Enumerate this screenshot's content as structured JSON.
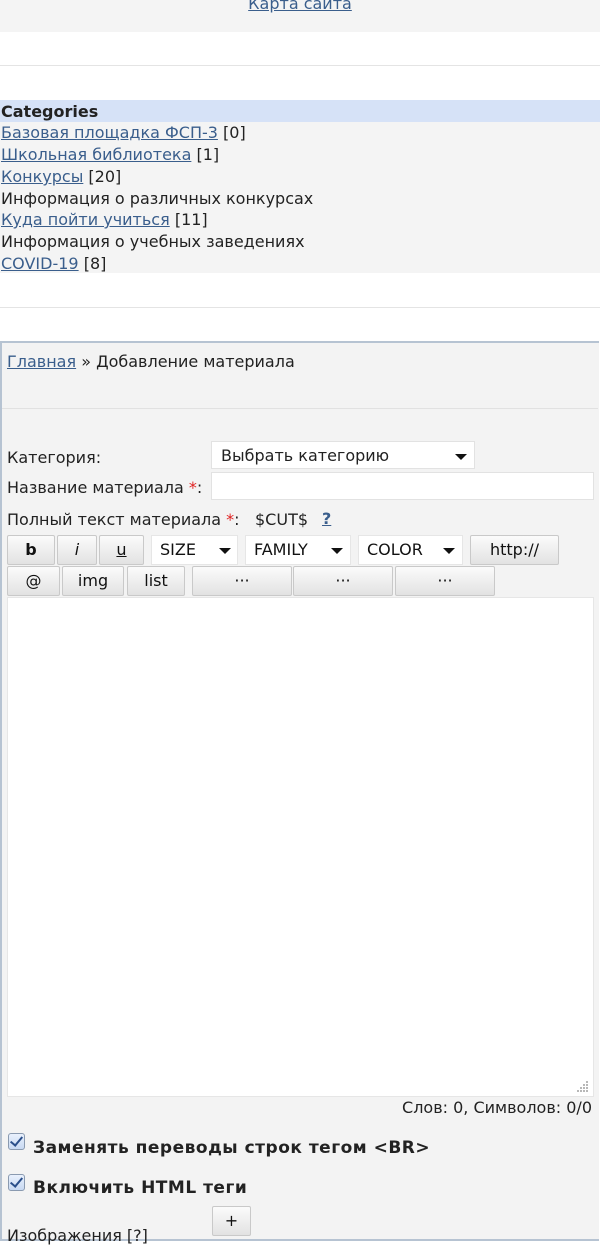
{
  "footer": {
    "sitemap_label": "Карта сайта"
  },
  "categories": {
    "header": "Categories",
    "items": [
      {
        "name": "Базовая площадка ФСП-3",
        "count": "[0]"
      },
      {
        "name": "Школьная библиотека",
        "count": "[1]"
      },
      {
        "name": "Конкурсы",
        "count": "[20]",
        "description": "Информация о различных конкурсах"
      },
      {
        "name": "Куда пойти учиться",
        "count": "[11]",
        "description": "Информация о учебных заведениях"
      },
      {
        "name": "COVID-19",
        "count": "[8]"
      }
    ]
  },
  "breadcrumb": {
    "home": "Главная",
    "separator": " » ",
    "current": "Добавление материала"
  },
  "form": {
    "category_label": "Категория:",
    "category_value": "Выбрать категорию",
    "title_label": "Название материала ",
    "title_value": "",
    "required_mark": "*",
    "colon": ":",
    "fulltext_label": "Полный текст материала ",
    "cut_tag": "$CUT$",
    "help_mark": "?",
    "toolbar": {
      "bold": "b",
      "italic": "i",
      "underline": "u",
      "size": "SIZE",
      "family": "FAMILY",
      "color": "COLOR",
      "url": "http://",
      "email": "@",
      "img": "img",
      "list": "list",
      "more1": "···",
      "more2": "···",
      "more3": "···"
    },
    "editor_text": "",
    "counter": "Слов: 0, Символов: 0/0",
    "br_option": "Заменять переводы строк тегом <BR>",
    "br_checked": true,
    "html_option": "Включить HTML теги",
    "html_checked": true,
    "images_label": "Изображения [?]",
    "add_image": "+"
  },
  "colors": {
    "accent_link": "#3a5e8c",
    "header_bg": "#d6e2f7",
    "panel_border": "#b6c3d2",
    "required": "#e02020"
  }
}
